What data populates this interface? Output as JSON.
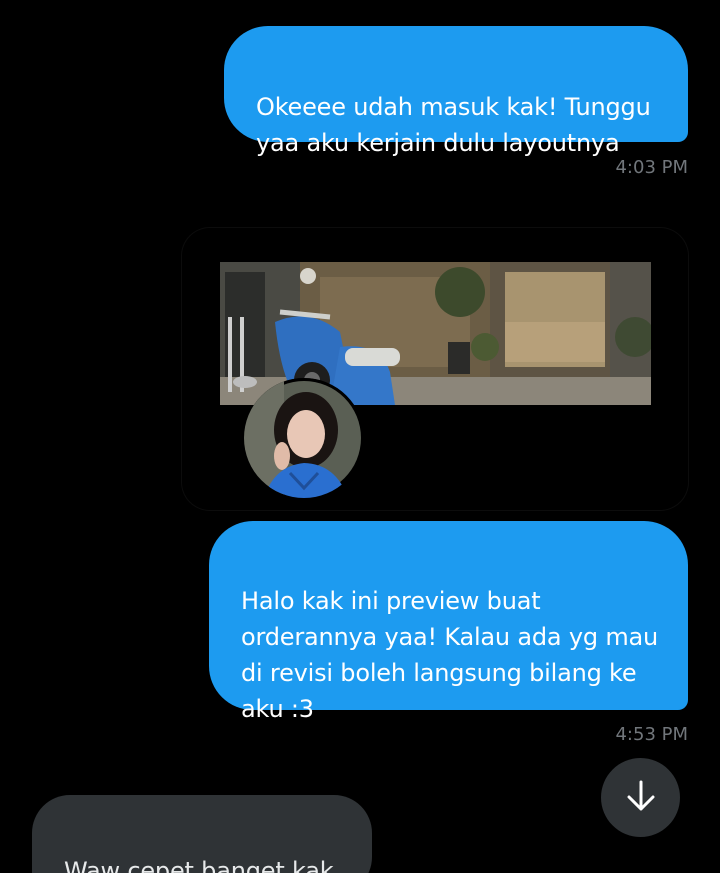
{
  "messages": [
    {
      "text": "Okeeee udah masuk kak! Tunggu\nyaa aku kerjain dulu layoutnya",
      "direction": "outgoing",
      "time": "4:03 PM"
    },
    {
      "text": "Halo kak ini preview buat\norderannya yaa! Kalau ada yg mau\ndi revisi boleh langsung bilang ke\naku :3",
      "direction": "outgoing",
      "time": "4:53 PM"
    },
    {
      "text": "Waw cepet banget kak",
      "direction": "incoming"
    }
  ],
  "colors": {
    "outgoing_bubble": "#1d9bf0",
    "incoming_bubble": "#2f3336",
    "background": "#000000",
    "timestamp": "#71767b"
  },
  "icons": {
    "scroll_down": "arrow-down-icon"
  }
}
